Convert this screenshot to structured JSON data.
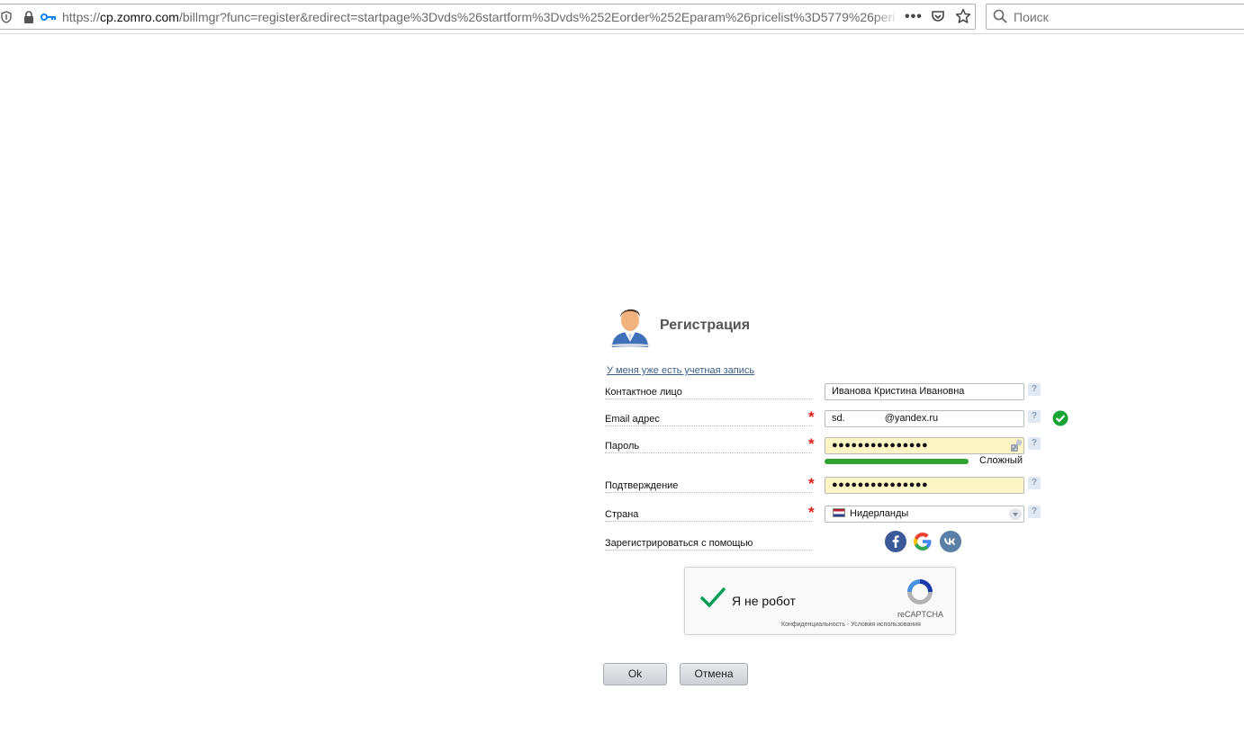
{
  "browser": {
    "url_host": "cp.zomro.com",
    "url_prefix": "https://",
    "url_rest": "/billmgr?func=register&redirect=startpage%3Dvds%26startform%3Dvds%252Eorder%252Eparam%26pricelist%3D5779%26perio",
    "search_placeholder": "Поиск"
  },
  "form": {
    "title": "Регистрация",
    "have_account_link": "У меня уже есть учетная запись",
    "fields": {
      "contact": {
        "label": "Контактное лицо",
        "value": "Иванова Кристина Ивановна",
        "required": false
      },
      "email": {
        "label": "Email адрес",
        "value_prefix": "sd.",
        "value_suffix": "@yandex.ru",
        "required": true,
        "valid": true
      },
      "password": {
        "label": "Пароль",
        "value": "●●●●●●●●●●●●●●●",
        "required": true,
        "strength_text": "Сложный"
      },
      "confirm": {
        "label": "Подтверждение",
        "value": "●●●●●●●●●●●●●●●",
        "required": true
      },
      "country": {
        "label": "Страна",
        "value": "Нидерланды",
        "required": true
      },
      "social": {
        "label": "Зарегистрироваться с помощью"
      }
    },
    "required_mark": "*",
    "help_mark": "?",
    "captcha": {
      "label": "Я не робот",
      "brand": "reCAPTCHA",
      "links": "Конфиденциальность - Условия использования"
    },
    "buttons": {
      "ok": "Ok",
      "cancel": "Отмена"
    }
  },
  "colors": {
    "accent_green": "#34a133",
    "required_red": "#e21b1b",
    "facebook": "#3b5998",
    "vk": "#5b7fa6"
  }
}
